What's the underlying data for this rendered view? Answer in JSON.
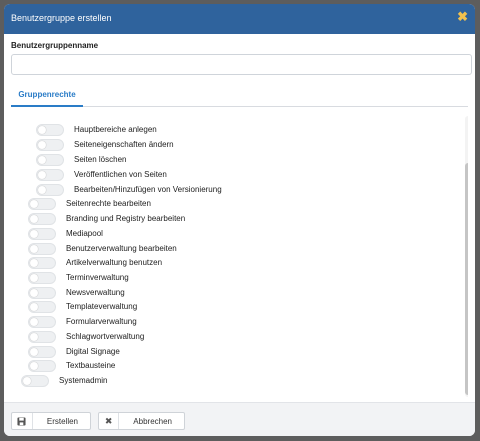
{
  "dialog": {
    "title": "Benutzergruppe erstellen",
    "close_icon": "✖"
  },
  "form": {
    "name_label": "Benutzergruppenname",
    "name_value": "",
    "name_placeholder": ""
  },
  "tabs": [
    {
      "label": "Gruppenrechte",
      "active": true
    }
  ],
  "permissions": [
    {
      "label": "Hauptbereiche anlegen",
      "enabled": false
    },
    {
      "label": "Seiteneigenschaften ändern",
      "enabled": false
    },
    {
      "label": "Seiten löschen",
      "enabled": false
    },
    {
      "label": "Veröffentlichen von Seiten",
      "enabled": false
    },
    {
      "label": "Bearbeiten/Hinzufügen von Versionierung",
      "enabled": false
    },
    {
      "label": "Seitenrechte bearbeiten",
      "enabled": false
    },
    {
      "label": "Branding und Registry bearbeiten",
      "enabled": false
    },
    {
      "label": "Mediapool",
      "enabled": false
    },
    {
      "label": "Benutzerverwaltung bearbeiten",
      "enabled": false
    },
    {
      "label": "Artikelverwaltung benutzen",
      "enabled": false
    },
    {
      "label": "Terminverwaltung",
      "enabled": false
    },
    {
      "label": "Newsverwaltung",
      "enabled": false
    },
    {
      "label": "Templateverwaltung",
      "enabled": false
    },
    {
      "label": "Formularverwaltung",
      "enabled": false
    },
    {
      "label": "Schlagwortverwaltung",
      "enabled": false
    },
    {
      "label": "Digital Signage",
      "enabled": false
    },
    {
      "label": "Textbausteine",
      "enabled": false
    },
    {
      "label": "Systemadmin",
      "enabled": false
    }
  ],
  "footer": {
    "create_label": "Erstellen",
    "create_icon": "save-icon",
    "cancel_label": "Abbrechen",
    "cancel_icon": "close-icon"
  },
  "colors": {
    "header": "#2f639d",
    "close_icon": "#f2c14e",
    "tab_active": "#2a7cc7"
  }
}
